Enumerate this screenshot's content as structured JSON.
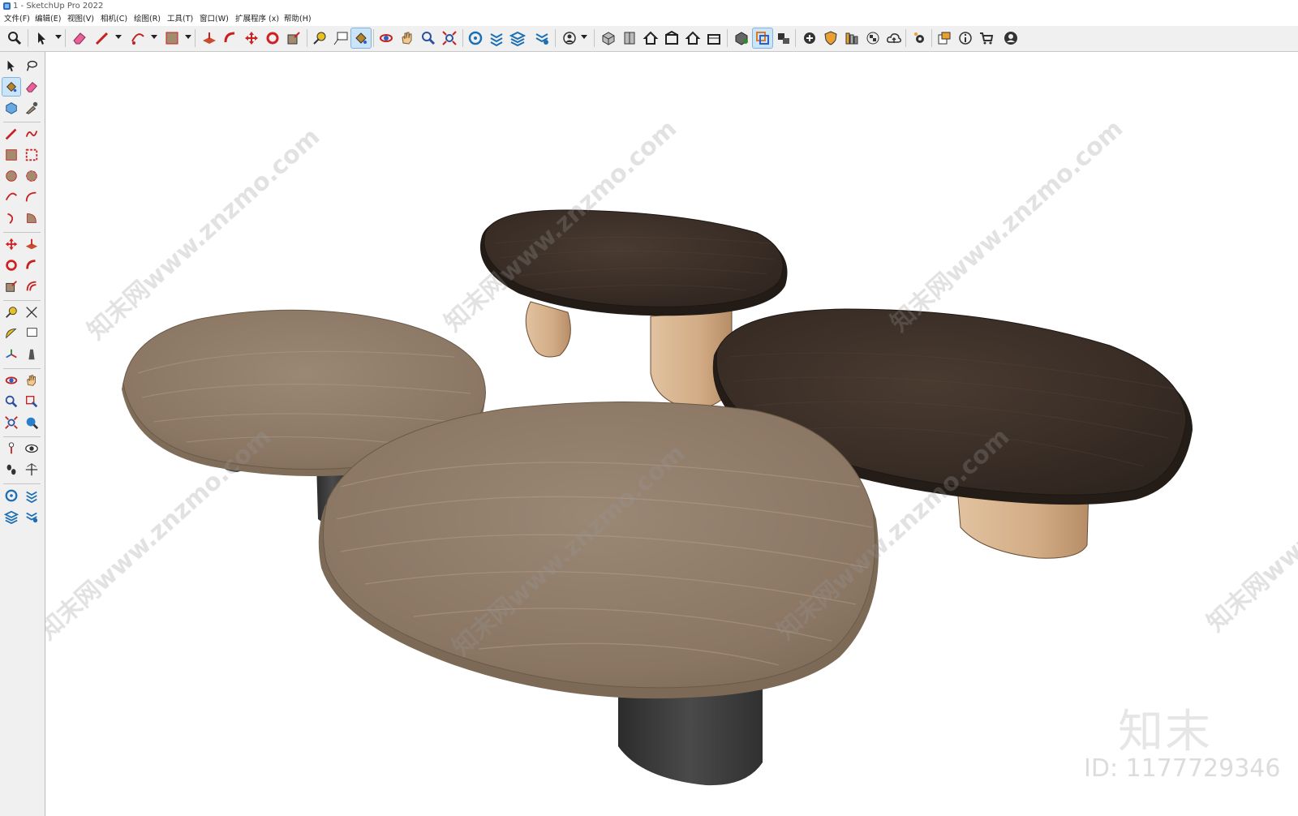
{
  "window": {
    "title": "1 - SketchUp Pro 2022"
  },
  "menu": [
    {
      "label": "文件(F)"
    },
    {
      "label": "编辑(E)"
    },
    {
      "label": "视图(V)"
    },
    {
      "label": "相机(C)"
    },
    {
      "label": "绘图(R)"
    },
    {
      "label": "工具(T)"
    },
    {
      "label": "窗口(W)"
    },
    {
      "label": "扩展程序 (x)"
    },
    {
      "label": "帮助(H)"
    }
  ],
  "watermark": {
    "text": "知末网www.znzmo.com",
    "logo": "知末",
    "id_label": "ID: 1177729346"
  },
  "colors": {
    "marble": "#8e7b68",
    "dark_wood": "#3e3129",
    "tan_base": "#d2ac85",
    "black_base": "#3c3c3c",
    "toolbar_bg": "#f0f0f0",
    "active_tool": "#cce4f7"
  }
}
